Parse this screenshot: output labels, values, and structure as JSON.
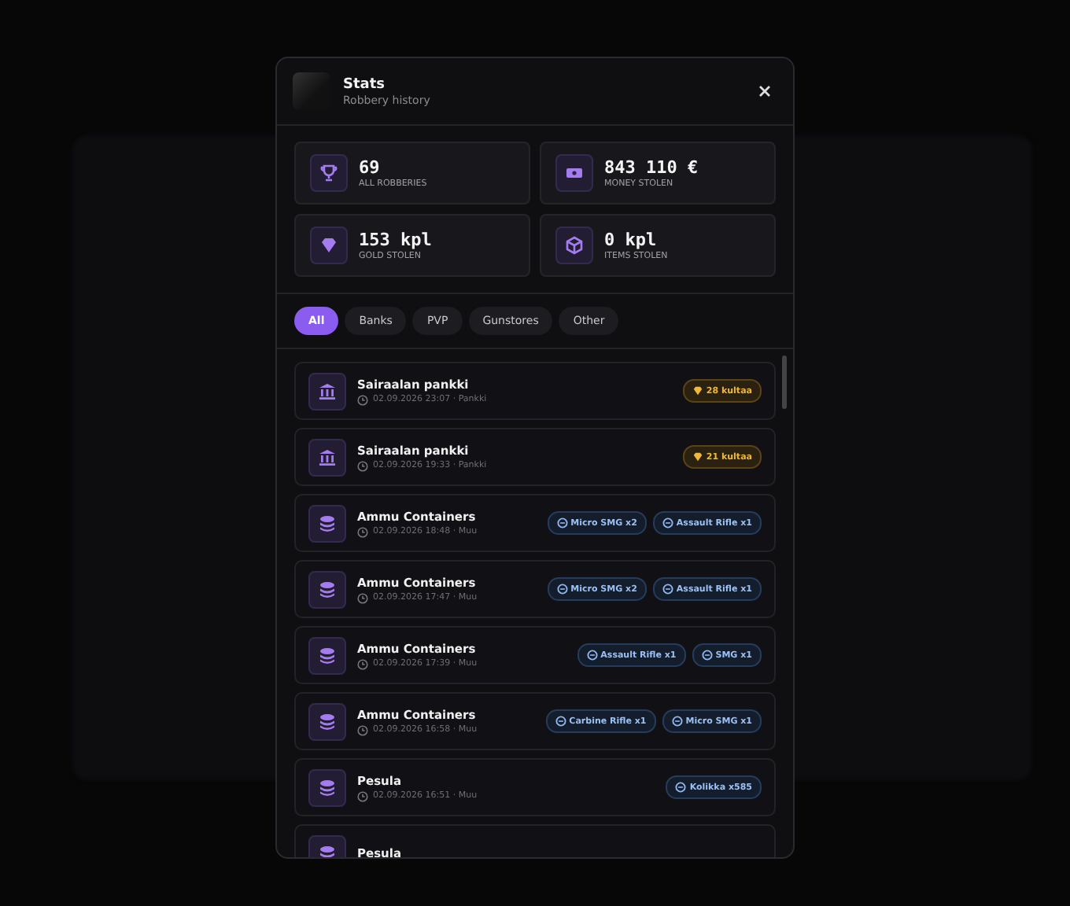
{
  "header": {
    "title": "Stats",
    "subtitle": "Robbery history"
  },
  "stats": [
    {
      "value": "69",
      "label": "ALL ROBBERIES"
    },
    {
      "value": "843 110 €",
      "label": "MONEY STOLEN"
    },
    {
      "value": "153 kpl",
      "label": "GOLD STOLEN"
    },
    {
      "value": "0 kpl",
      "label": "ITEMS STOLEN"
    }
  ],
  "filters": [
    {
      "label": "All",
      "selected": true
    },
    {
      "label": "Banks",
      "selected": false
    },
    {
      "label": "PVP",
      "selected": false
    },
    {
      "label": "Gunstores",
      "selected": false
    },
    {
      "label": "Other",
      "selected": false
    }
  ],
  "history": [
    {
      "kind": "bank",
      "title": "Sairaalan pankki",
      "meta": "02.09.2026 23:07 · Pankki",
      "badges": [
        {
          "kind": "gold",
          "label": "28 kultaa"
        }
      ]
    },
    {
      "kind": "bank",
      "title": "Sairaalan pankki",
      "meta": "02.09.2026 19:33 · Pankki",
      "badges": [
        {
          "kind": "gold",
          "label": "21 kultaa"
        }
      ]
    },
    {
      "kind": "other",
      "title": "Ammu Containers",
      "meta": "02.09.2026 18:48 · Muu",
      "badges": [
        {
          "kind": "item",
          "label": "Micro SMG x2"
        },
        {
          "kind": "item",
          "label": "Assault Rifle x1"
        }
      ]
    },
    {
      "kind": "other",
      "title": "Ammu Containers",
      "meta": "02.09.2026 17:47 · Muu",
      "badges": [
        {
          "kind": "item",
          "label": "Micro SMG x2"
        },
        {
          "kind": "item",
          "label": "Assault Rifle x1"
        }
      ]
    },
    {
      "kind": "other",
      "title": "Ammu Containers",
      "meta": "02.09.2026 17:39 · Muu",
      "badges": [
        {
          "kind": "item",
          "label": "Assault Rifle x1"
        },
        {
          "kind": "item",
          "label": "SMG x1"
        }
      ]
    },
    {
      "kind": "other",
      "title": "Ammu Containers",
      "meta": "02.09.2026 16:58 · Muu",
      "badges": [
        {
          "kind": "item",
          "label": "Carbine Rifle x1"
        },
        {
          "kind": "item",
          "label": "Micro SMG x1"
        }
      ]
    },
    {
      "kind": "other",
      "title": "Pesula",
      "meta": "02.09.2026 16:51 · Muu",
      "badges": [
        {
          "kind": "item",
          "label": "Kolikka x585"
        }
      ]
    },
    {
      "kind": "other",
      "title": "Pesula"
    }
  ]
}
